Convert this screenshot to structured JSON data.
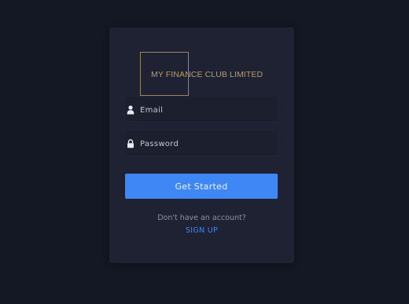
{
  "brand": {
    "name": "MY FINANCE CLUB LIMITED",
    "color": "#b79d6a"
  },
  "form": {
    "email": {
      "placeholder": "Email",
      "value": "",
      "icon": "user-icon"
    },
    "password": {
      "placeholder": "Password",
      "value": "",
      "icon": "lock-icon"
    },
    "submit_label": "Get Started"
  },
  "footer": {
    "prompt": "Don't have an account?",
    "signup_label": "SIGN UP"
  },
  "colors": {
    "background": "#141824",
    "card": "#1e2232",
    "accent": "#3f87f5"
  }
}
